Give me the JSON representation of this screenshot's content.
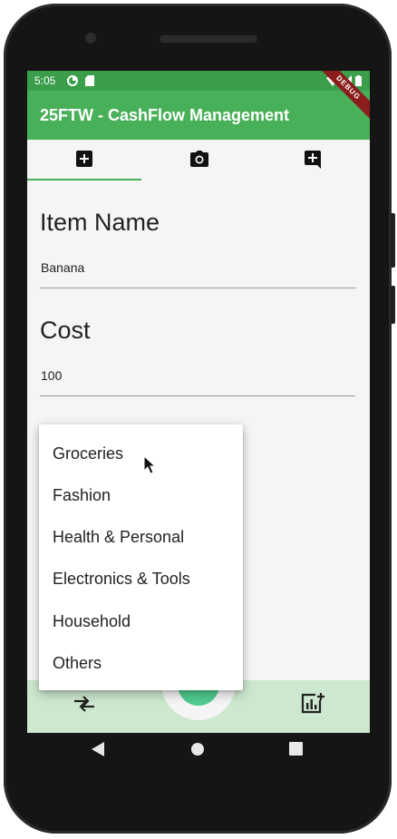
{
  "status_bar": {
    "time": "5:05"
  },
  "app_bar": {
    "title": "25FTW - CashFlow Management",
    "debug_banner": "DEBUG"
  },
  "tabs": [
    {
      "icon": "add-box-icon"
    },
    {
      "icon": "camera-icon"
    },
    {
      "icon": "add-comment-icon"
    }
  ],
  "form": {
    "item_name": {
      "label": "Item Name",
      "value": "Banana"
    },
    "cost": {
      "label": "Cost",
      "value": "100"
    }
  },
  "category_menu": {
    "items": [
      "Groceries",
      "Fashion",
      "Health & Personal",
      "Electronics & Tools",
      "Household",
      "Others"
    ]
  },
  "bottom_nav": {
    "left_icon": "compare-arrows-icon",
    "right_icon": "add-chart-icon",
    "fab_icon": "add-icon"
  },
  "colors": {
    "status_bar": "#3a9e4a",
    "app_bar": "#49b05a",
    "bottom_nav": "#cde8cf",
    "fab": "#50cc8f"
  }
}
